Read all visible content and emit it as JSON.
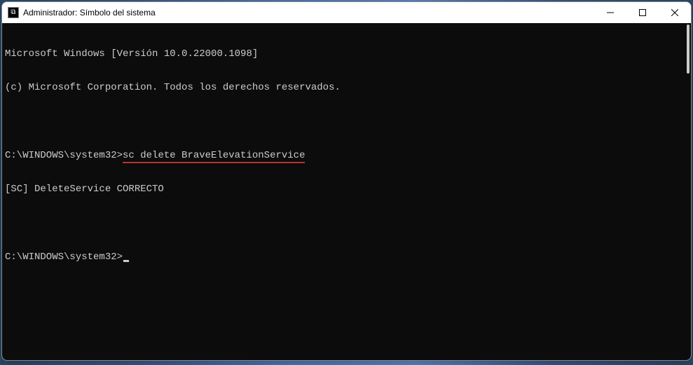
{
  "titlebar": {
    "icon_text": "C:\\",
    "title": "Administrador: Símbolo del sistema",
    "minimize_label": "Minimize",
    "maximize_label": "Maximize",
    "close_label": "Close"
  },
  "terminal": {
    "line1": "Microsoft Windows [Versión 10.0.22000.1098]",
    "line2": "(c) Microsoft Corporation. Todos los derechos reservados.",
    "prompt1_path": "C:\\WINDOWS\\system32>",
    "prompt1_cmd": "sc delete BraveElevationService",
    "output1": "[SC] DeleteService CORRECTO",
    "prompt2_path": "C:\\WINDOWS\\system32>"
  }
}
